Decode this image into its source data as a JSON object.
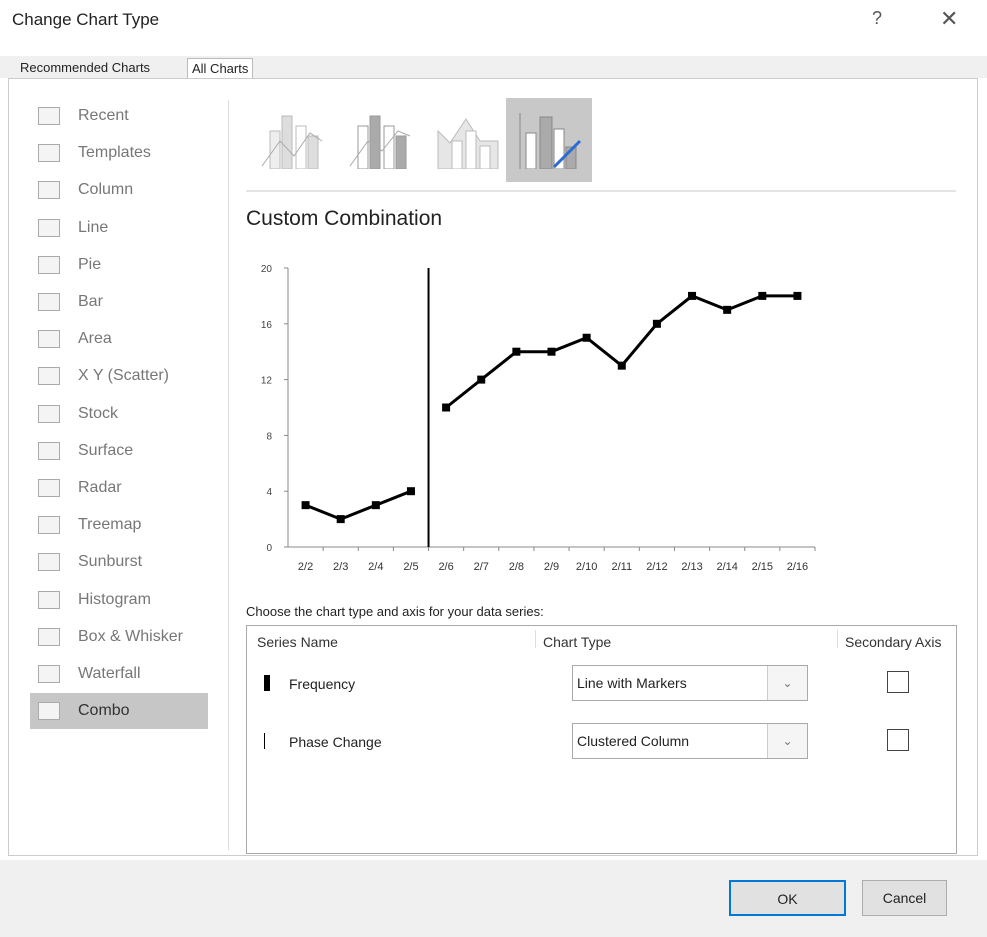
{
  "dialog": {
    "title": "Change Chart Type",
    "help": "?",
    "close": "✕"
  },
  "tabs": [
    {
      "label": "Recommended Charts"
    },
    {
      "label": "All Charts"
    }
  ],
  "sidebar": {
    "items": [
      {
        "label": "Recent",
        "icon": "recent-icon"
      },
      {
        "label": "Templates",
        "icon": "folder-icon"
      },
      {
        "label": "Column",
        "icon": "column-chart-icon"
      },
      {
        "label": "Line",
        "icon": "line-chart-icon"
      },
      {
        "label": "Pie",
        "icon": "pie-chart-icon"
      },
      {
        "label": "Bar",
        "icon": "bar-chart-icon"
      },
      {
        "label": "Area",
        "icon": "area-chart-icon"
      },
      {
        "label": "X Y (Scatter)",
        "icon": "scatter-chart-icon"
      },
      {
        "label": "Stock",
        "icon": "stock-chart-icon"
      },
      {
        "label": "Surface",
        "icon": "surface-chart-icon"
      },
      {
        "label": "Radar",
        "icon": "radar-chart-icon"
      },
      {
        "label": "Treemap",
        "icon": "treemap-icon"
      },
      {
        "label": "Sunburst",
        "icon": "sunburst-icon"
      },
      {
        "label": "Histogram",
        "icon": "histogram-icon"
      },
      {
        "label": "Box & Whisker",
        "icon": "box-whisker-icon"
      },
      {
        "label": "Waterfall",
        "icon": "waterfall-icon"
      },
      {
        "label": "Combo",
        "icon": "combo-chart-icon",
        "selected": true
      }
    ]
  },
  "main": {
    "heading": "Custom Combination",
    "choose_label": "Choose the chart type and axis for your data series:",
    "columns": [
      "Series Name",
      "Chart Type",
      "Secondary Axis"
    ],
    "series": [
      {
        "name": "Frequency",
        "type": "Line with Markers",
        "secondary": false
      },
      {
        "name": "Phase Change",
        "type": "Clustered Column",
        "secondary": false
      }
    ]
  },
  "buttons": {
    "ok": "OK",
    "cancel": "Cancel"
  },
  "chart_data": {
    "type": "line",
    "title": "",
    "categories": [
      "2/2",
      "2/3",
      "2/4",
      "2/5",
      "2/6",
      "2/7",
      "2/8",
      "2/9",
      "2/10",
      "2/11",
      "2/12",
      "2/13",
      "2/14",
      "2/15",
      "2/16"
    ],
    "series": [
      {
        "name": "Frequency",
        "values": [
          3,
          2,
          3,
          4,
          null,
          null,
          null,
          null,
          null,
          null,
          null,
          null,
          null,
          null,
          null
        ]
      },
      {
        "name": "Frequency",
        "values": [
          null,
          null,
          null,
          null,
          10,
          12,
          14,
          14,
          15,
          13,
          16,
          18,
          17,
          18,
          18
        ]
      }
    ],
    "phase_change_after": "2/5",
    "ylim": [
      0,
      20
    ],
    "yticks": [
      "0",
      "4",
      "8",
      "12",
      "16",
      "20"
    ],
    "grid": false
  }
}
